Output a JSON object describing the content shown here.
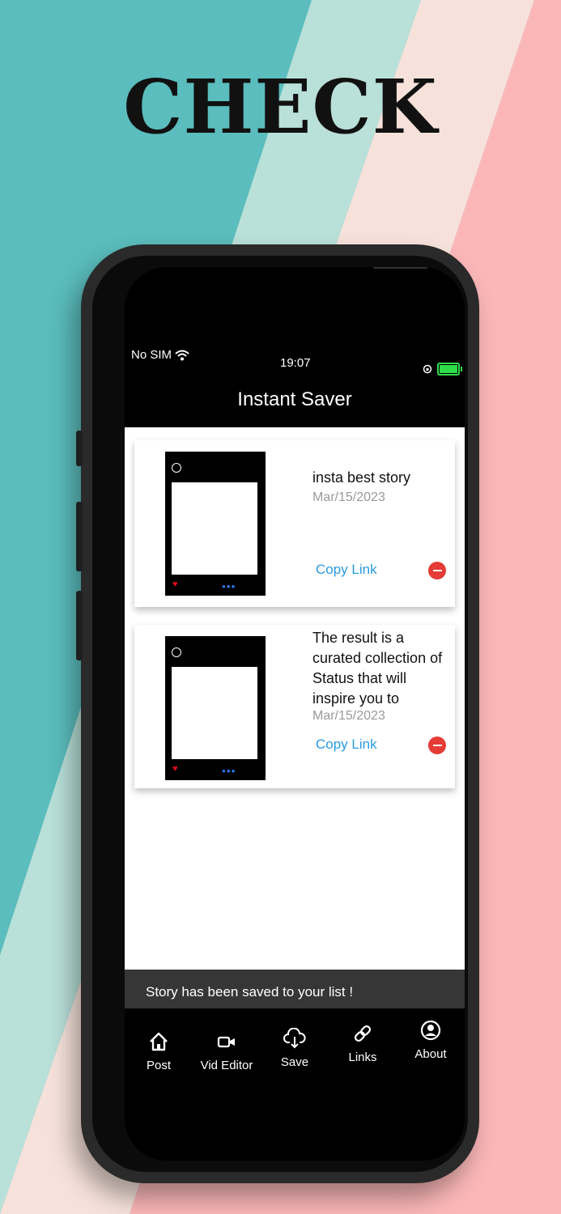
{
  "headline": "CHECK",
  "status_bar": {
    "carrier": "No SIM",
    "time": "19:07"
  },
  "app": {
    "title": "Instant Saver"
  },
  "stories": [
    {
      "title": "insta best story",
      "date": "Mar/15/2023",
      "link_label": "Copy Link"
    },
    {
      "title": "The result is a curated collection of Status that will inspire you to",
      "date": "Mar/15/2023",
      "link_label": "Copy Link"
    }
  ],
  "toast": {
    "message": "Story has been saved to your list !"
  },
  "tabs": [
    {
      "label": "Post",
      "icon": "home-icon"
    },
    {
      "label": "Vid Editor",
      "icon": "video-icon"
    },
    {
      "label": "Save",
      "icon": "cloud-download-icon"
    },
    {
      "label": "Links",
      "icon": "link-icon"
    },
    {
      "label": "About",
      "icon": "user-circle-icon"
    }
  ],
  "colors": {
    "teal": "#5bbdbd",
    "mint": "#b9e0d9",
    "peach": "#f7e2db",
    "pink": "#fbb7b8",
    "link_blue": "#2a9be0",
    "delete_red": "#e53a35"
  }
}
